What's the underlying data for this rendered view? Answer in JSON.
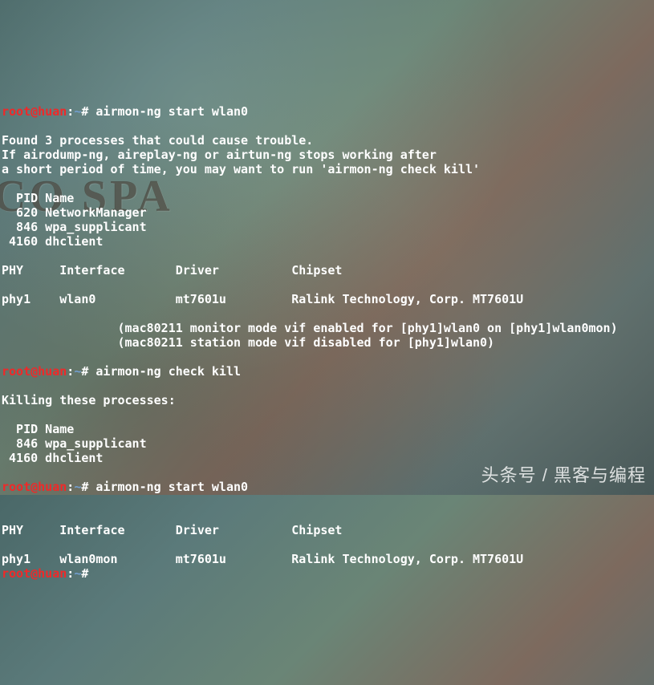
{
  "prompt": {
    "user": "root@huan",
    "colon": ":",
    "path": "~",
    "hash": "#"
  },
  "bg_sign": "JCO SPA",
  "watermark": "头条号 / 黑客与编程",
  "block1": {
    "cmd": " airmon-ng start wlan0",
    "out": [
      "",
      "Found 3 processes that could cause trouble.",
      "If airodump-ng, aireplay-ng or airtun-ng stops working after",
      "a short period of time, you may want to run 'airmon-ng check kill'",
      "",
      "  PID Name",
      "  620 NetworkManager",
      "  846 wpa_supplicant",
      " 4160 dhclient",
      "",
      "PHY     Interface       Driver          Chipset",
      "",
      "phy1    wlan0           mt7601u         Ralink Technology, Corp. MT7601U",
      "",
      "                (mac80211 monitor mode vif enabled for [phy1]wlan0 on [phy1]wlan0mon)",
      "                (mac80211 station mode vif disabled for [phy1]wlan0)",
      ""
    ]
  },
  "block2": {
    "cmd": " airmon-ng check kill",
    "out": [
      "",
      "Killing these processes:",
      "",
      "  PID Name",
      "  846 wpa_supplicant",
      " 4160 dhclient",
      ""
    ]
  },
  "block3": {
    "cmd": " airmon-ng start wlan0",
    "out": [
      "",
      "",
      "PHY     Interface       Driver          Chipset",
      "",
      "phy1    wlan0mon        mt7601u         Ralink Technology, Corp. MT7601U"
    ]
  },
  "block4": {
    "cmd": ""
  }
}
